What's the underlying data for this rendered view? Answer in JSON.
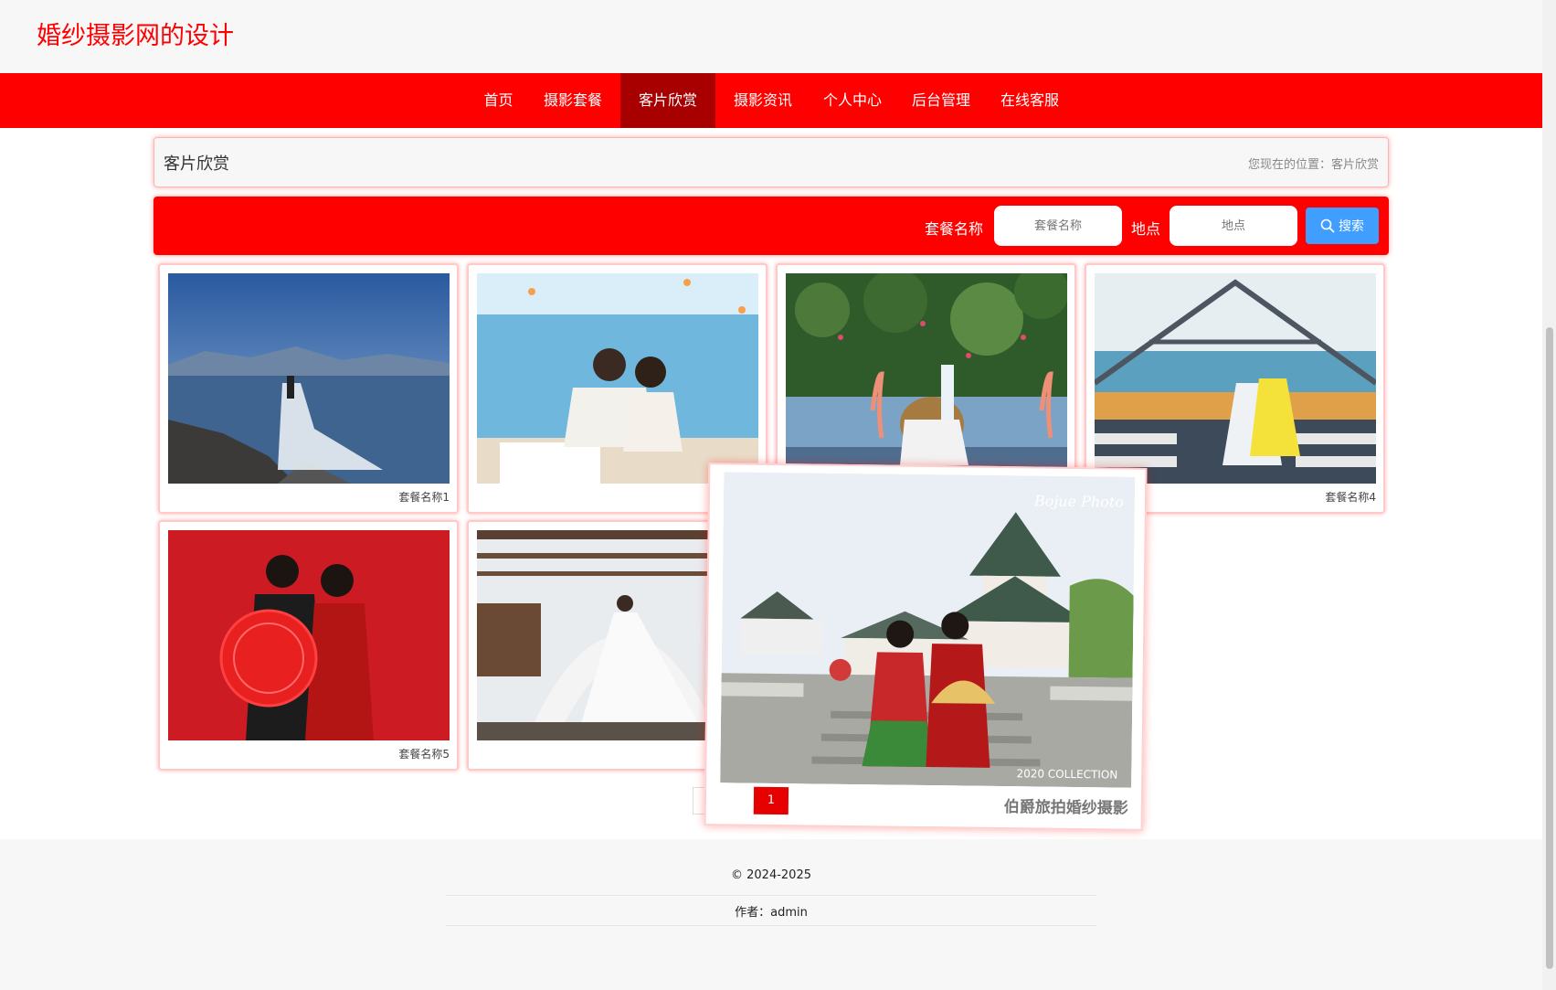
{
  "site": {
    "title": "婚纱摄影网的设计"
  },
  "nav": {
    "items": [
      {
        "label": "首页"
      },
      {
        "label": "摄影套餐"
      },
      {
        "label": "客片欣赏"
      },
      {
        "label": "摄影资讯"
      },
      {
        "label": "个人中心"
      },
      {
        "label": "后台管理"
      },
      {
        "label": "在线客服"
      }
    ],
    "active": "客片欣赏"
  },
  "breadcrumb": {
    "title": "客片欣赏",
    "location": "您现在的位置：客片欣赏"
  },
  "search": {
    "package_label": "套餐名称",
    "package_placeholder": "套餐名称",
    "location_label": "地点",
    "location_placeholder": "地点",
    "button_label": "搜索"
  },
  "cards": [
    {
      "caption": "套餐名称1"
    },
    {
      "caption": ""
    },
    {
      "caption": ""
    },
    {
      "caption": "套餐名称4"
    },
    {
      "caption": "套餐名称5"
    },
    {
      "caption": ""
    }
  ],
  "pagination": {
    "current": "1"
  },
  "popup": {
    "caption": "伯爵旅拍婚纱摄影",
    "watermark": "2020 COLLECTION"
  },
  "footer": {
    "copyright": "© 2024-2025",
    "author": "作者：admin"
  },
  "colors": {
    "brand": "#ff0000",
    "nav_active": "#a80000",
    "search_button": "#409eff"
  }
}
